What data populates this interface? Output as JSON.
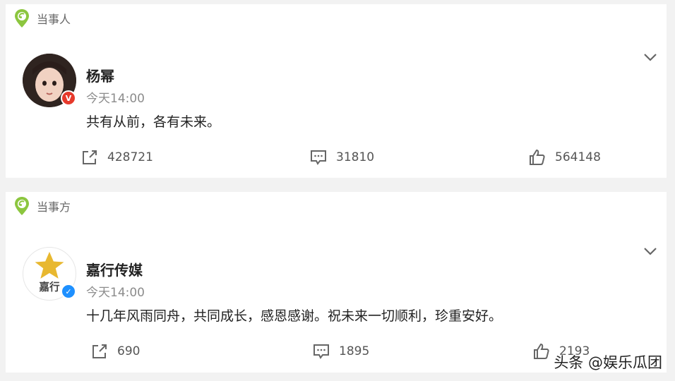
{
  "posts": [
    {
      "label": "当事人",
      "author": "杨幂",
      "time": "今天14:00",
      "content": "共有从前，各有未来。",
      "verified_badge": "V",
      "verified_color": "#e6392b",
      "stats": {
        "repost": "428721",
        "comment": "31810",
        "like": "564148"
      }
    },
    {
      "label": "当事方",
      "author": "嘉行传媒",
      "logo_text": "嘉行",
      "time": "今天14:00",
      "content": "十几年风雨同舟，共同成长，感恩感谢。祝未来一切顺利，珍重安好。",
      "verified_badge": "✓",
      "verified_color": "#1e90ff",
      "stats": {
        "repost": "690",
        "comment": "1895",
        "like": "2193"
      }
    }
  ],
  "watermark": "头条 @娱乐瓜团",
  "colors": {
    "pin": "#8cc63f",
    "background": "#f2f2f2"
  }
}
